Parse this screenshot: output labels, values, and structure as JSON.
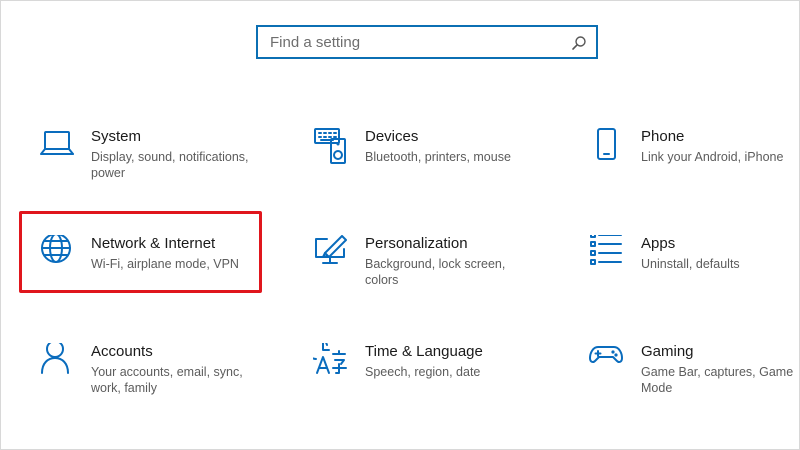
{
  "search": {
    "placeholder": "Find a setting"
  },
  "tiles": [
    {
      "title": "System",
      "desc": "Display, sound, notifications, power",
      "icon": "laptop-icon"
    },
    {
      "title": "Devices",
      "desc": "Bluetooth, printers, mouse",
      "icon": "keyboard-speaker-icon"
    },
    {
      "title": "Phone",
      "desc": "Link your Android, iPhone",
      "icon": "phone-icon"
    },
    {
      "title": "Network & Internet",
      "desc": "Wi-Fi, airplane mode, VPN",
      "icon": "globe-icon"
    },
    {
      "title": "Personalization",
      "desc": "Background, lock screen, colors",
      "icon": "monitor-pen-icon"
    },
    {
      "title": "Apps",
      "desc": "Uninstall, defaults",
      "icon": "app-list-icon"
    },
    {
      "title": "Accounts",
      "desc": "Your accounts, email, sync, work, family",
      "icon": "person-icon"
    },
    {
      "title": "Time & Language",
      "desc": "Speech, region, date",
      "icon": "time-language-icon"
    },
    {
      "title": "Gaming",
      "desc": "Game Bar, captures, Game Mode",
      "icon": "gamepad-icon"
    }
  ],
  "colors": {
    "accent": "#0a6cbd",
    "highlight": "#e0161d"
  }
}
